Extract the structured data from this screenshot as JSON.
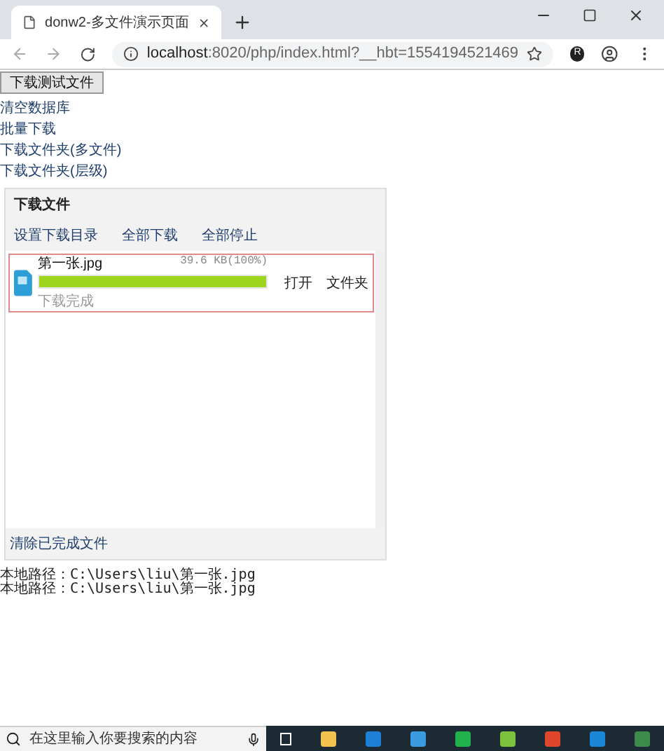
{
  "browser": {
    "tab_title": "donw2-多文件演示页面",
    "url_host": "localhost",
    "url_rest": ":8020/php/index.html?__hbt=1554194521469",
    "avatar_letter": "R"
  },
  "page": {
    "test_button": "下载测试文件",
    "links": [
      "清空数据库",
      "批量下载",
      "下载文件夹(多文件)",
      "下载文件夹(层级)"
    ],
    "panel": {
      "title": "下载文件",
      "actions": [
        "设置下载目录",
        "全部下载",
        "全部停止"
      ],
      "items": [
        {
          "name": "第一张.jpg",
          "size": "39.6 KB(100%)",
          "level": 1,
          "status": "下载完成",
          "selected": true,
          "actions": [
            "打开",
            "文件夹"
          ]
        }
      ],
      "footer": "清除已完成文件"
    },
    "log": [
      "本地路径：C:\\Users\\liu\\第一张.jpg",
      "本地路径：C:\\Users\\liu\\第一张.jpg"
    ]
  },
  "taskbar": {
    "search_placeholder": "在这里输入你要搜索的内容"
  }
}
